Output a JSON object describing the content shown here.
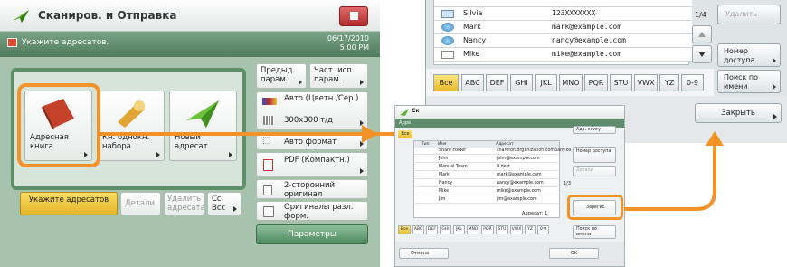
{
  "left_screen": {
    "title": "Сканиров. и Отправка",
    "message": "Укажите адресатов.",
    "date": "06/17/2010",
    "time": "5:00 PM",
    "tiles": [
      {
        "label": "Адресная книга",
        "icon": "address-book-icon"
      },
      {
        "label": "Кн. однокн. набора",
        "icon": "one-touch-icon"
      },
      {
        "label": "Новый адресат",
        "icon": "new-destination-icon"
      }
    ],
    "settings": {
      "prev_settings": "Предыд. парам.",
      "favorites": "Част. исп. парам.",
      "color_mode": "Авто (Цветн./Сер.)",
      "resolution": "300x300 т/д",
      "size": "Авто формат",
      "format": "PDF (Компактн.)",
      "duplex": "2-сторонний оригинал",
      "mixed": "Оригиналы разл. форм.",
      "options": "Параметры"
    },
    "bottom": {
      "specify": "Укажите адресатов",
      "details": "Детали",
      "delete": "Удалить адресата",
      "cc": "Cc Bcc"
    }
  },
  "right_screen": {
    "rows": [
      {
        "name": "Silvia",
        "address": "123XXXXXXX",
        "icon": "fax-icon"
      },
      {
        "name": "Mark",
        "address": "mark@example.com",
        "icon": "email-icon"
      },
      {
        "name": "Nancy",
        "address": "nancy@example.com",
        "icon": "email-icon"
      },
      {
        "name": "Mike",
        "address": "mike@example.com",
        "icon": "file-icon"
      }
    ],
    "page": "1/4",
    "delete": "Удалить",
    "access_number": "Номер доступа",
    "search_name": "Поиск по имени",
    "close": "Закрыть",
    "keys": [
      "Все",
      "ABC",
      "DEF",
      "GHI",
      "JKL",
      "MNO",
      "PQR",
      "STU",
      "VWX",
      "YZ",
      "0-9"
    ]
  },
  "small_screen": {
    "title": "Ск",
    "bar": "Адре",
    "all_label": "Все",
    "col_type": "Тип",
    "col_name": "Имя",
    "col_addr": "Адресат",
    "rows": [
      {
        "name": "Share Folder",
        "address": "sharefoh.organization.company.co"
      },
      {
        "name": "John",
        "address": "john@example.com"
      },
      {
        "name": "Manual Team",
        "address": "0 dest."
      },
      {
        "name": "Mark",
        "address": "mark@example.com"
      },
      {
        "name": "Nancy",
        "address": "nancy@example.com"
      },
      {
        "name": "Mike",
        "address": "mike@example.com"
      },
      {
        "name": "Jim",
        "address": "jim@example.com"
      }
    ],
    "dest_count": "Адресат: 1",
    "page": "1/3",
    "access_top": "Адр. книгу",
    "access": "Номер доступа",
    "details": "Детали",
    "register": "Зарегис.",
    "search": "Поиск по имени",
    "cancel": "Отмена",
    "ok": "OK",
    "keys": [
      "Все",
      "ABC",
      "DEF",
      "GHI",
      "JKL",
      "MNO",
      "PQR",
      "STU",
      "VWX",
      "YZ",
      "0-9"
    ]
  },
  "colors": {
    "highlight": "#f39227",
    "green": "#4f7c5c"
  }
}
